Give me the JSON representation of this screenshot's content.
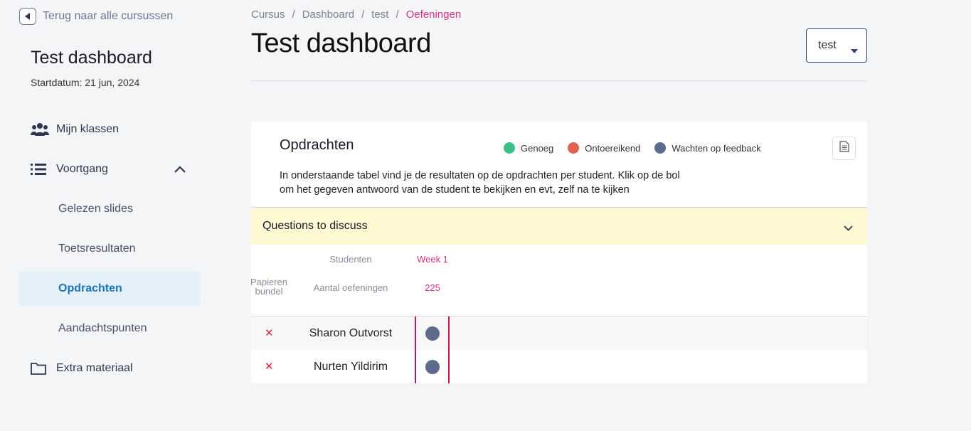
{
  "sidebar": {
    "back_label": "Terug naar alle cursussen",
    "course_title": "Test dashboard",
    "start_label": "Startdatum:",
    "start_date": "21 jun, 2024",
    "items": [
      {
        "label": "Mijn klassen",
        "icon": "users-icon"
      },
      {
        "label": "Voortgang",
        "icon": "list-icon",
        "expanded": true
      },
      {
        "label": "Gelezen slides"
      },
      {
        "label": "Toetsresultaten"
      },
      {
        "label": "Opdrachten",
        "active": true
      },
      {
        "label": "Aandachtspunten"
      },
      {
        "label": "Extra materiaal",
        "icon": "folder-icon"
      }
    ]
  },
  "breadcrumb": [
    "Cursus",
    "Dashboard",
    "test",
    "Oefeningen"
  ],
  "page_title": "Test dashboard",
  "select": {
    "value": "test"
  },
  "card": {
    "title": "Opdrachten",
    "legend": [
      {
        "label": "Genoeg",
        "color": "#3dbd8a"
      },
      {
        "label": "Ontoereikend",
        "color": "#e0634f"
      },
      {
        "label": "Wachten op feedback",
        "color": "#5f6b8a"
      }
    ],
    "description_line1": "In onderstaande tabel vind je de resultaten op de opdrachten per student. Klik op de bol",
    "description_line2": "om het gegeven antwoord van de student te bekijken en evt, zelf na te kijken",
    "accordion_label": "Questions to discuss",
    "table": {
      "col_students": "Studenten",
      "col_week": "Week 1",
      "col_paper_line1": "Papieren",
      "col_paper_line2": "bundel",
      "col_count_label": "Aantal oefeningen",
      "col_count_value": "225",
      "rows": [
        {
          "name": "Sharon Outvorst",
          "status": "Wachten op feedback"
        },
        {
          "name": "Nurten Yildirim",
          "status": "Wachten op feedback"
        }
      ]
    }
  },
  "colors": {
    "accent": "#d63384",
    "active_nav_bg": "#e3f0f8",
    "active_nav_text": "#1a74b8",
    "accordion_bg": "#fef9d3"
  }
}
